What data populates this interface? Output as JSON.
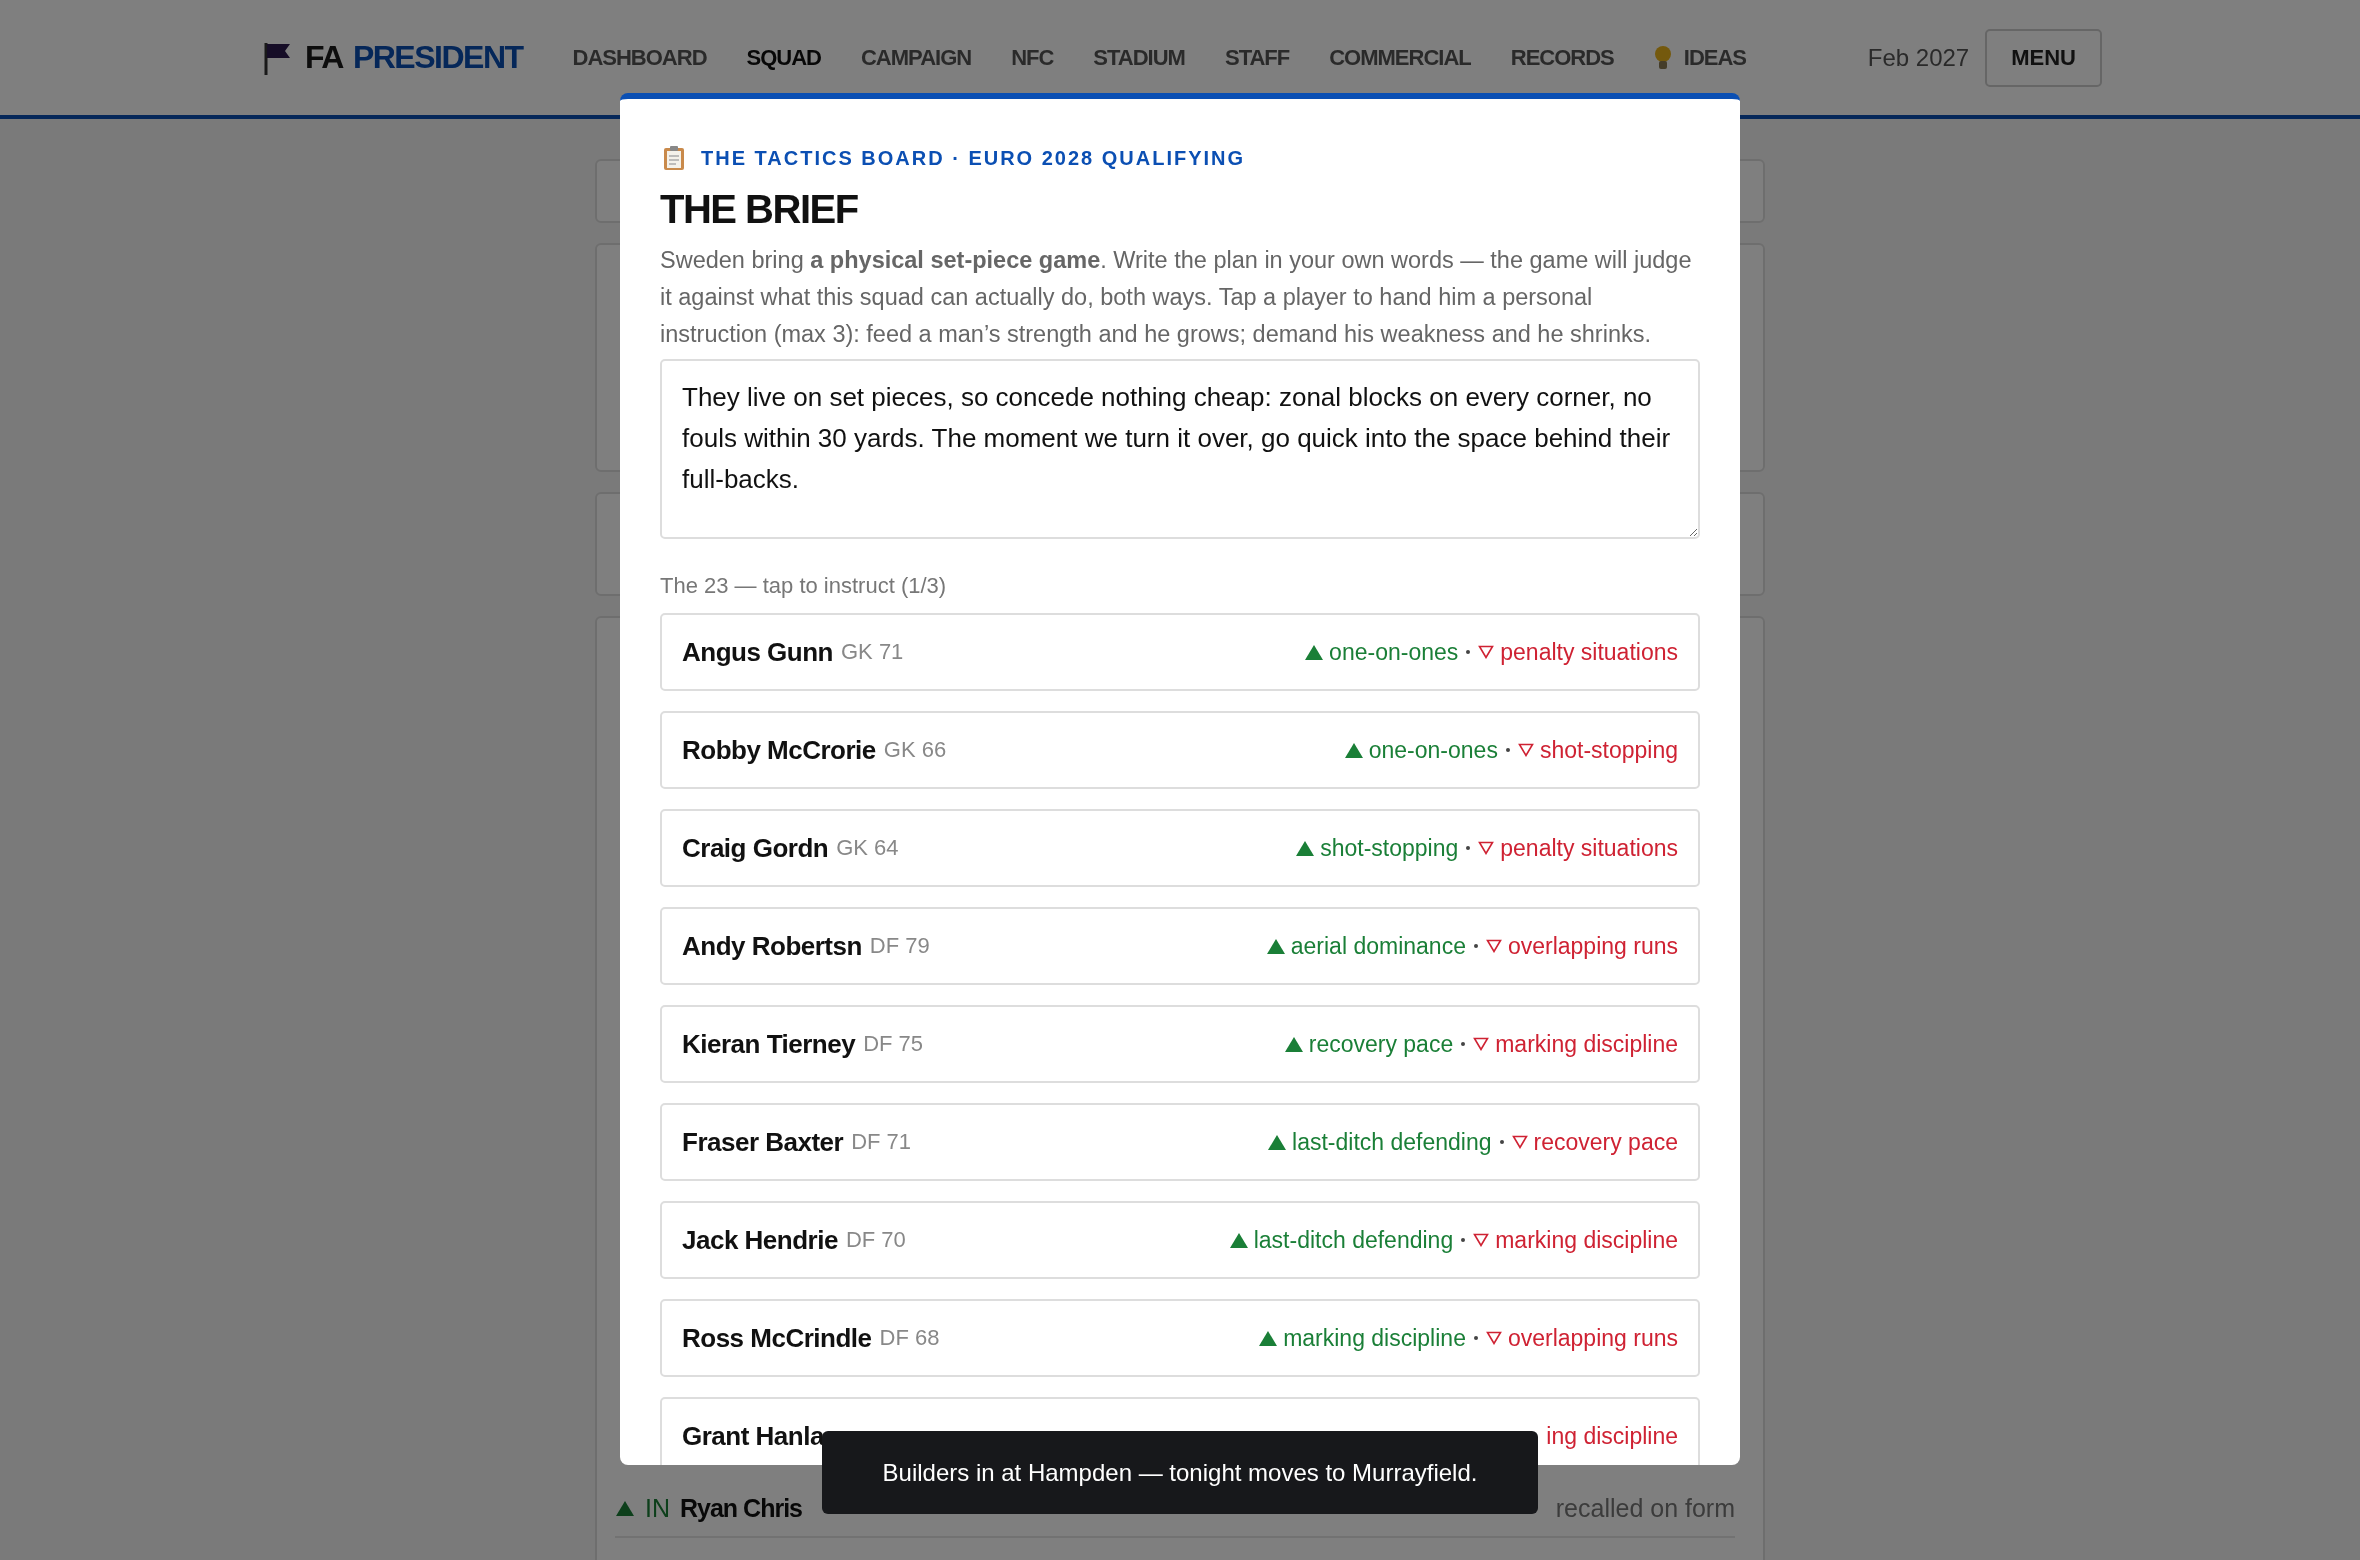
{
  "header": {
    "logo": {
      "lead": "FA",
      "rest": "PRESIDENT"
    },
    "nav": [
      {
        "label": "DASHBOARD",
        "selected": false
      },
      {
        "label": "SQUAD",
        "selected": true
      },
      {
        "label": "CAMPAIGN",
        "selected": false
      },
      {
        "label": "NFC",
        "selected": false
      },
      {
        "label": "STADIUM",
        "selected": false
      },
      {
        "label": "STAFF",
        "selected": false
      },
      {
        "label": "COMMERCIAL",
        "selected": false
      },
      {
        "label": "RECORDS",
        "selected": false
      },
      {
        "label": "IDEAS",
        "selected": false,
        "kind": "idea"
      }
    ],
    "date": "Feb 2027",
    "menu": "MENU"
  },
  "modal": {
    "eyebrow": "THE TACTICS BOARD · EURO 2028 QUALIFYING",
    "title": "THE BRIEF",
    "intro": "Sweden bring **a physical set-piece game**. Write the plan in your own words — the game will judge it against what this squad can actually do, both ways. Tap a player to hand him a personal instruction (max 3): feed a man’s strength and he grows; demand his weakness and he shrinks.",
    "plan": "They live on set pieces, so concede nothing cheap: zonal blocks on every corner, no fouls within 30 yards. The moment we turn it over, go quick into the space behind their full-backs.",
    "squad_label": "The 23 — tap to instruct (1/3)",
    "players": [
      {
        "kind": "full",
        "name": "Angus Gunn",
        "pos": "GK 71",
        "strength": "one-on-ones",
        "weakness": "penalty situations"
      },
      {
        "kind": "full",
        "name": "Robby McCrorie",
        "pos": "GK 66",
        "strength": "one-on-ones",
        "weakness": "shot-stopping"
      },
      {
        "kind": "full",
        "name": "Craig Gordn",
        "pos": "GK 64",
        "strength": "shot-stopping",
        "weakness": "penalty situations"
      },
      {
        "kind": "full",
        "name": "Andy Robertsn",
        "pos": "DF 79",
        "strength": "aerial dominance",
        "weakness": "overlapping runs"
      },
      {
        "kind": "full",
        "name": "Kieran Tierney",
        "pos": "DF 75",
        "strength": "recovery pace",
        "weakness": "marking discipline"
      },
      {
        "kind": "full",
        "name": "Fraser Baxter",
        "pos": "DF 71",
        "strength": "last-ditch defending",
        "weakness": "recovery pace"
      },
      {
        "kind": "full",
        "name": "Jack Hendrie",
        "pos": "DF 70",
        "strength": "last-ditch defending",
        "weakness": "marking discipline"
      },
      {
        "kind": "full",
        "name": "Ross McCrindle",
        "pos": "DF 68",
        "strength": "marking discipline",
        "weakness": "overlapping runs"
      },
      {
        "kind": "partial",
        "name": "Grant Hanla",
        "weakness": "ing discipline"
      }
    ]
  },
  "background_rows": [
    {
      "tag": "IN",
      "name": "Ryan Chris",
      "note": "recalled on form"
    }
  ],
  "toast": "Builders in at Hampden — tonight moves to Murrayfield."
}
